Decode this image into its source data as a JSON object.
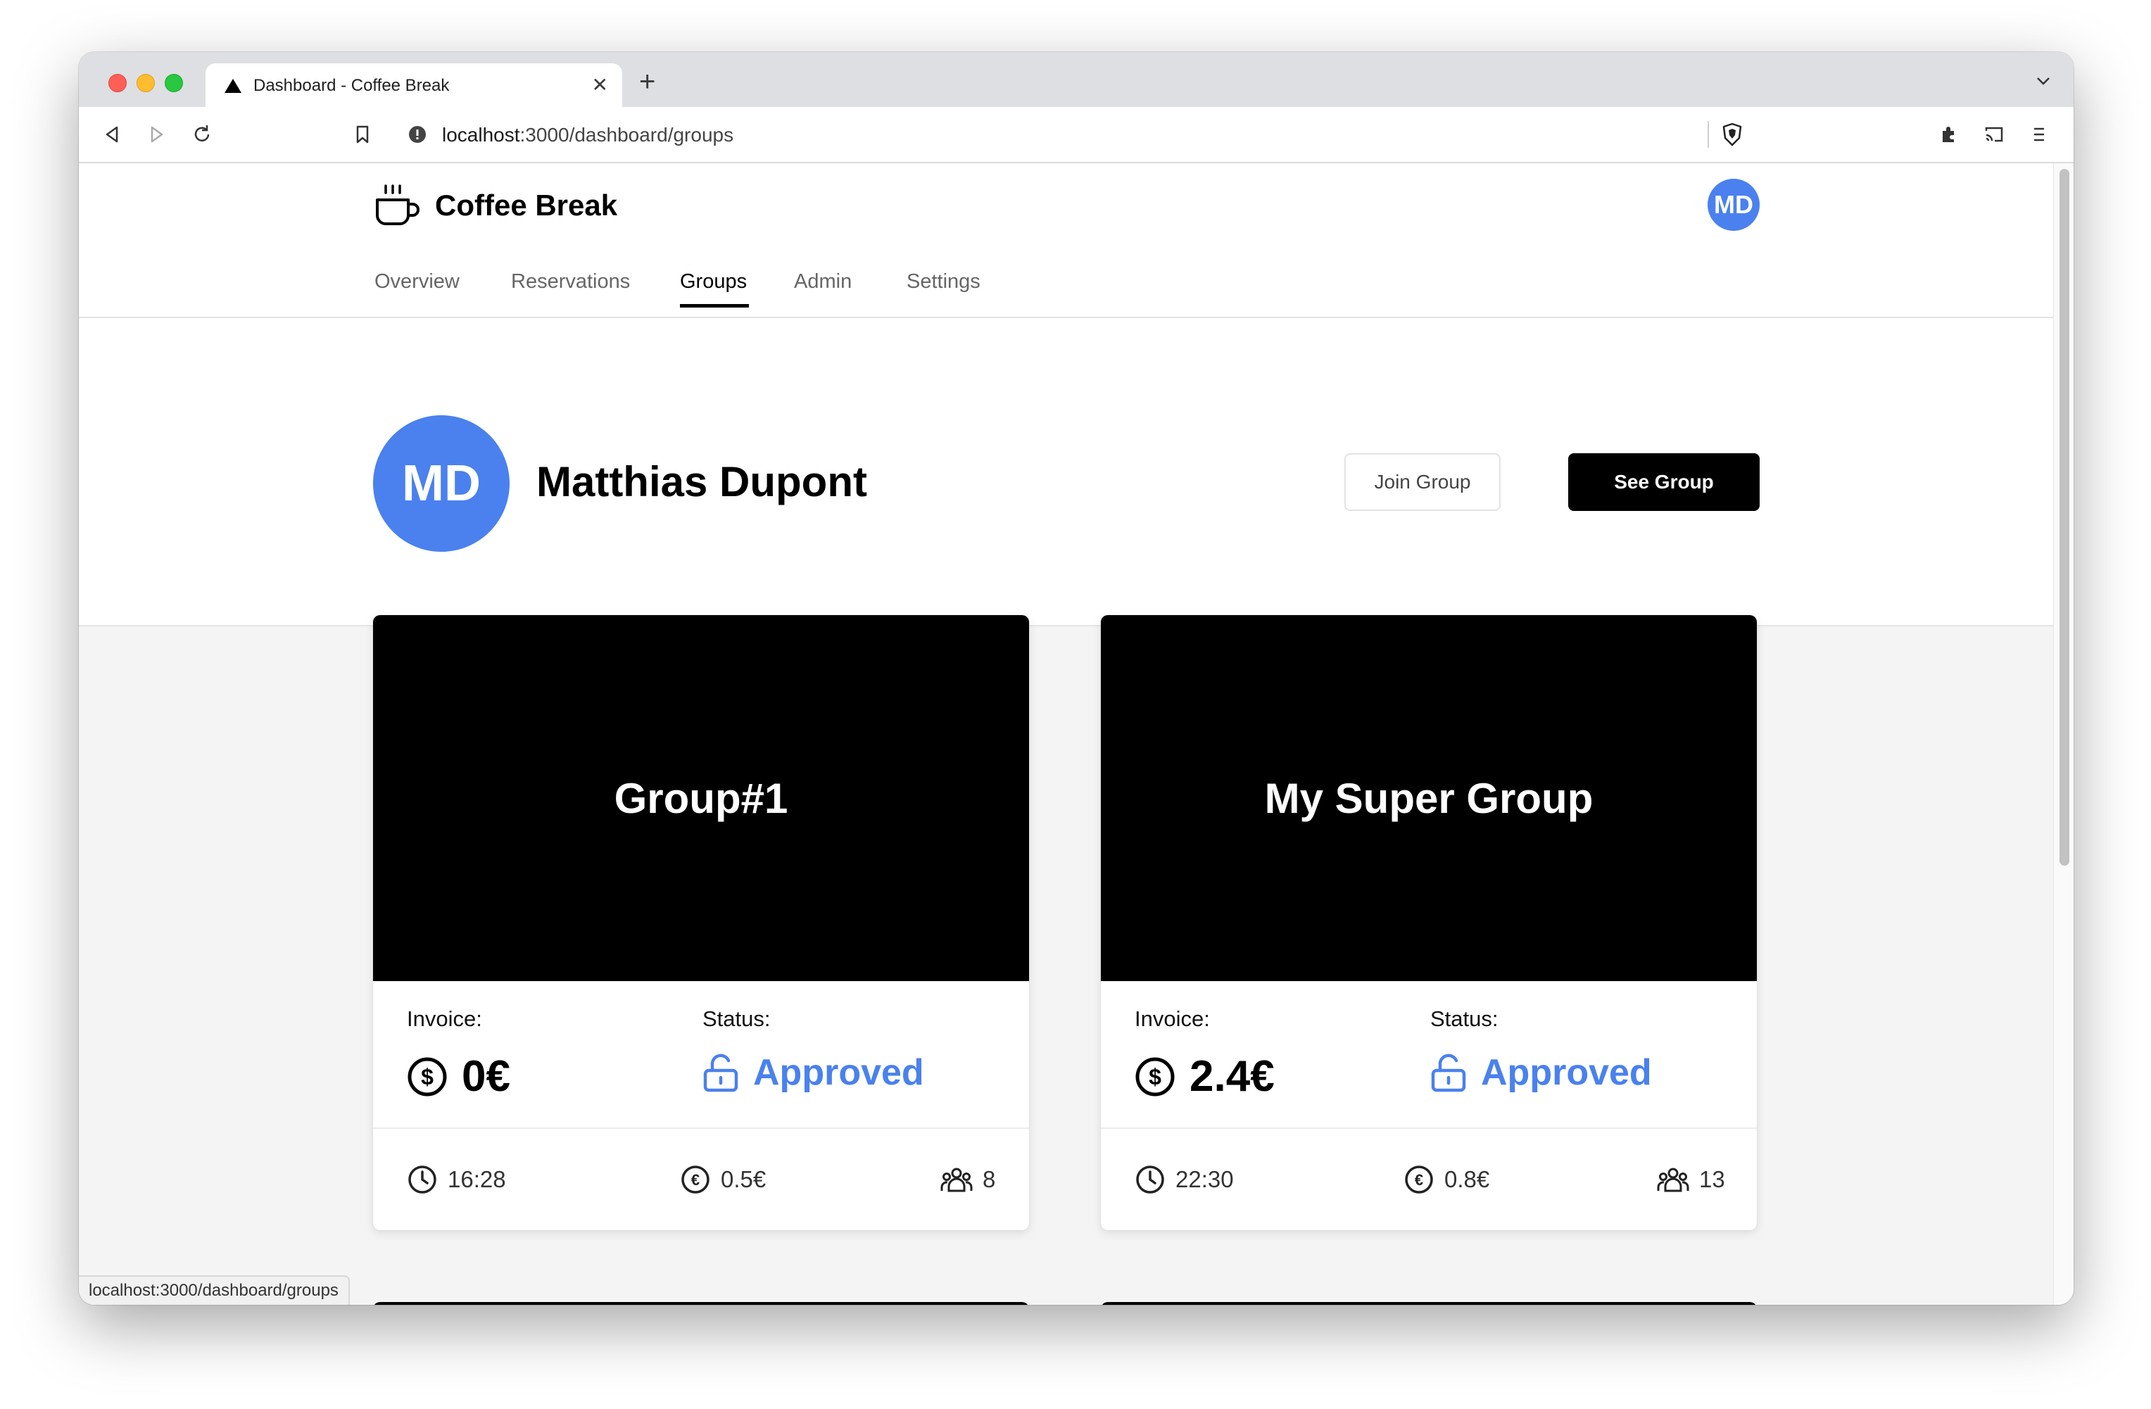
{
  "browser": {
    "tab_title": "Dashboard - Coffee Break",
    "url_host": "localhost",
    "url_path": ":3000/dashboard/groups",
    "status_url": "localhost:3000/dashboard/groups"
  },
  "app": {
    "brand": "Coffee Break",
    "avatar_initials": "MD",
    "nav": [
      {
        "label": "Overview",
        "active": false
      },
      {
        "label": "Reservations",
        "active": false
      },
      {
        "label": "Groups",
        "active": true
      },
      {
        "label": "Admin",
        "active": false
      },
      {
        "label": "Settings",
        "active": false
      }
    ]
  },
  "profile": {
    "initials": "MD",
    "name": "Matthias Dupont",
    "join_label": "Join Group",
    "see_label": "See Group"
  },
  "groups": [
    {
      "title": "Group#1",
      "invoice_label": "Invoice:",
      "invoice_value": "0€",
      "status_label": "Status:",
      "status_value": "Approved",
      "time": "16:28",
      "price": "0.5€",
      "members": "8"
    },
    {
      "title": "My Super Group",
      "invoice_label": "Invoice:",
      "invoice_value": "2.4€",
      "status_label": "Status:",
      "status_value": "Approved",
      "time": "22:30",
      "price": "0.8€",
      "members": "13"
    }
  ],
  "colors": {
    "accent": "#4a81ee",
    "card_hero": "#000000",
    "page_bg": "#f4f4f5"
  }
}
